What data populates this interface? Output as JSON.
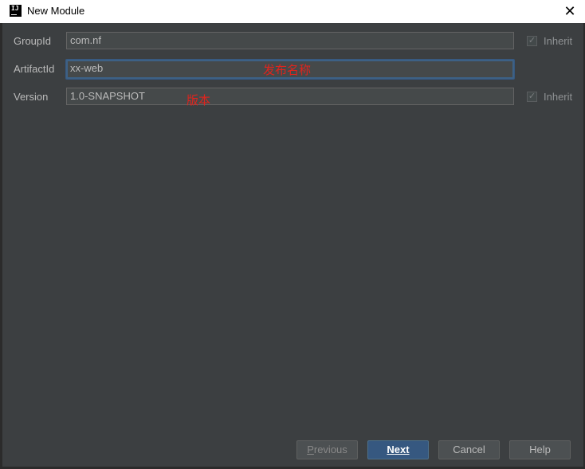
{
  "window": {
    "title": "New Module",
    "close_icon": "close-icon"
  },
  "form": {
    "group_id": {
      "label": "GroupId",
      "value": "com.nf",
      "inherit_label": "Inherit",
      "inherit_checked": true
    },
    "artifact_id": {
      "label": "ArtifactId",
      "value": "xx-web",
      "annotation": "发布名称"
    },
    "version": {
      "label": "Version",
      "value": "1.0-SNAPSHOT",
      "annotation": "版本",
      "inherit_label": "Inherit",
      "inherit_checked": true
    }
  },
  "buttons": {
    "previous": {
      "mnemonic": "P",
      "rest": "revious"
    },
    "next": {
      "mnemonic": "N",
      "rest": "ext"
    },
    "cancel": "Cancel",
    "help": "Help"
  },
  "colors": {
    "background": "#3c3f41",
    "accent": "#365880",
    "annotation": "#e0241d"
  }
}
